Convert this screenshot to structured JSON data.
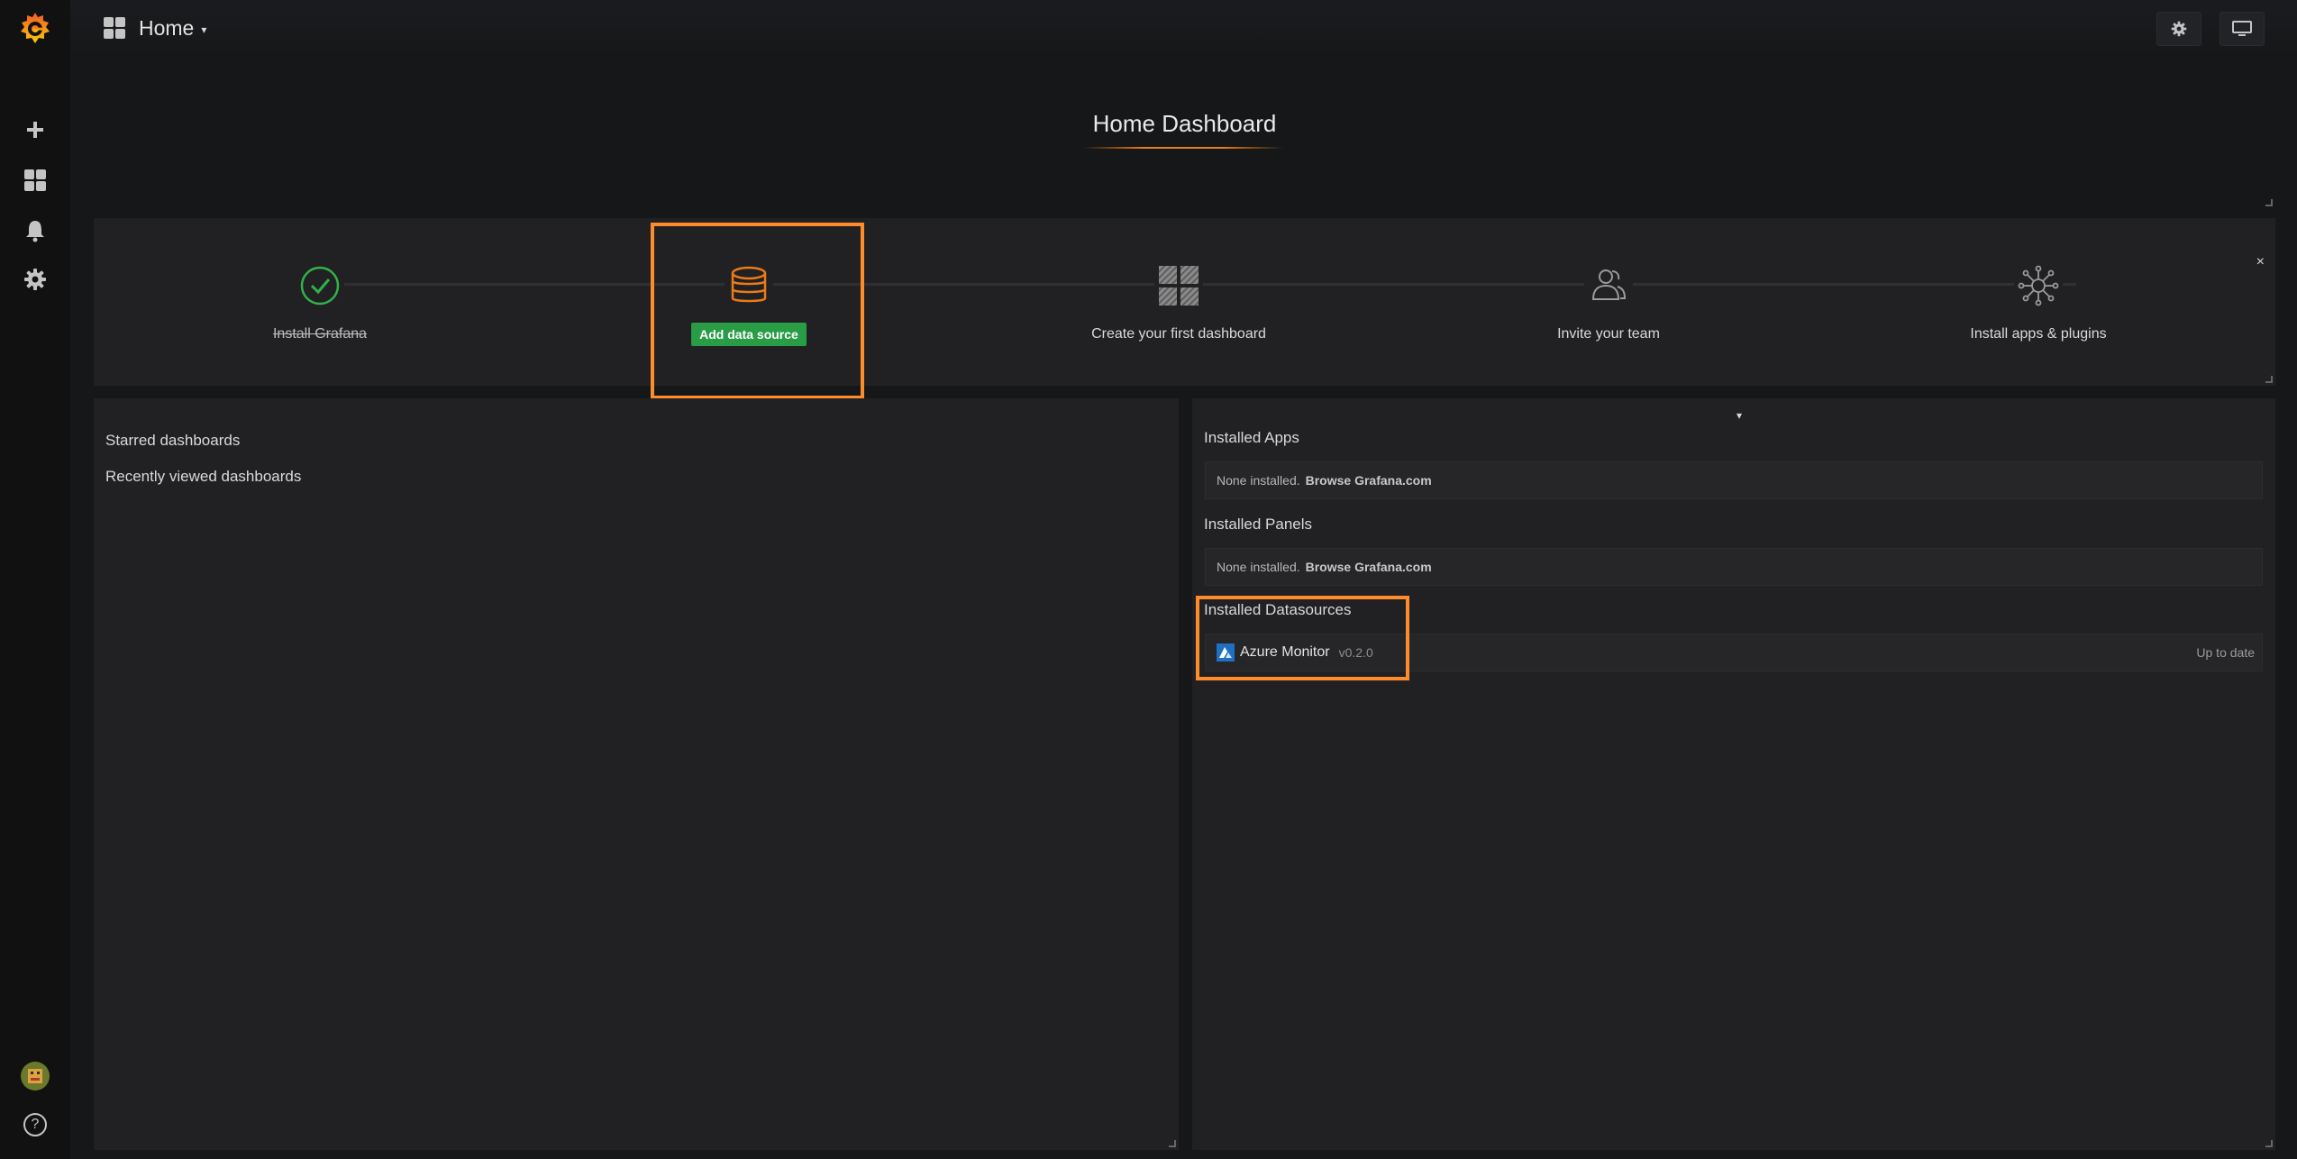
{
  "topbar": {
    "dashboard_name": "Home",
    "caret": "▾"
  },
  "sidebar": {
    "items": [
      {
        "name": "grafana-logo"
      },
      {
        "name": "create"
      },
      {
        "name": "dashboards"
      },
      {
        "name": "alerting"
      },
      {
        "name": "configuration"
      },
      {
        "name": "user-avatar"
      },
      {
        "name": "help"
      }
    ],
    "help_glyph": "?"
  },
  "title": "Home Dashboard",
  "getting_started": {
    "steps": [
      {
        "label": "Install Grafana",
        "done": true
      },
      {
        "label": "Add data source",
        "active": true
      },
      {
        "label": "Create your first dashboard"
      },
      {
        "label": "Invite your team"
      },
      {
        "label": "Install apps & plugins"
      }
    ],
    "close": "×"
  },
  "left_panel": {
    "starred": "Starred dashboards",
    "recent": "Recently viewed dashboards"
  },
  "right_panel": {
    "installed_apps": {
      "title": "Installed Apps",
      "empty_text": "None installed.",
      "link": "Browse Grafana.com"
    },
    "installed_panels": {
      "title": "Installed Panels",
      "empty_text": "None installed.",
      "link": "Browse Grafana.com"
    },
    "installed_datasources": {
      "title": "Installed Datasources",
      "items": [
        {
          "name": "Azure Monitor",
          "version": "v0.2.0",
          "status": "Up to date"
        }
      ]
    },
    "menu_caret": "▾"
  },
  "colors": {
    "accent_orange": "#eb7b18",
    "highlight_orange": "#ff8c2a",
    "success_green": "#299c46",
    "panel_bg": "#212124",
    "page_bg": "#161719"
  }
}
